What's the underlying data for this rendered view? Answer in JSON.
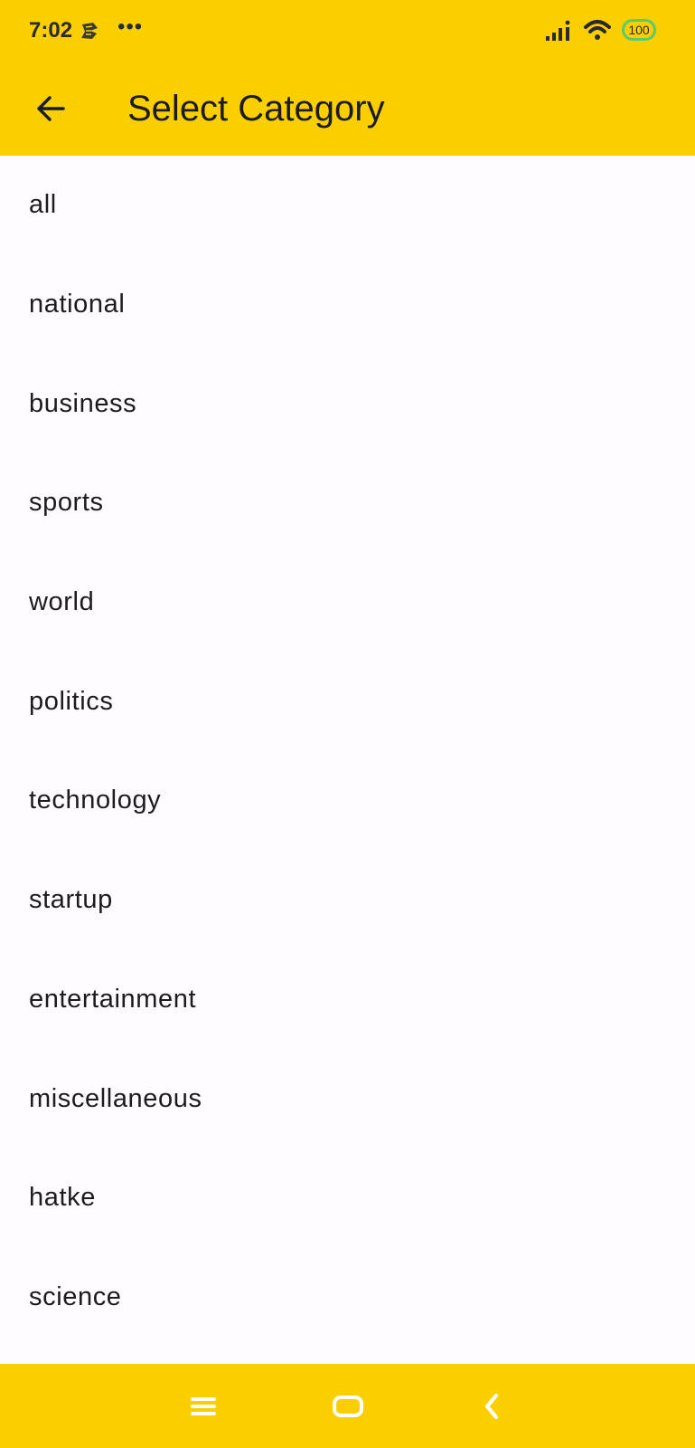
{
  "status_bar": {
    "time": "7:02",
    "more_dots": "•••",
    "battery": "100",
    "icons": [
      "app-notification-icon",
      "signal-icon",
      "wifi-icon",
      "battery-icon"
    ]
  },
  "app_bar": {
    "title": "Select Category",
    "back_icon": "arrow-back-icon"
  },
  "categories": [
    "all",
    "national",
    "business",
    "sports",
    "world",
    "politics",
    "technology",
    "startup",
    "entertainment",
    "miscellaneous",
    "hatke",
    "science"
  ],
  "nav_bar": {
    "icons": [
      "menu-icon",
      "home-icon",
      "back-chevron-icon"
    ]
  },
  "colors": {
    "accent": "#f9cf00",
    "background": "#fffbfe",
    "text": "#1c1b1f",
    "battery_outline": "#5cc96a"
  }
}
